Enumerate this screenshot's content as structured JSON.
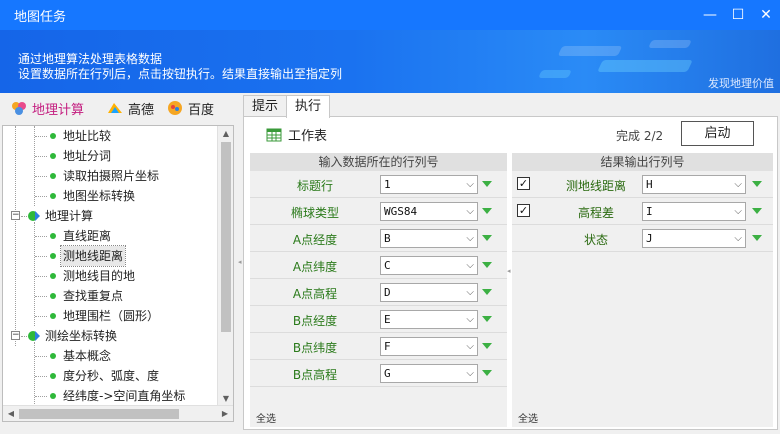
{
  "window": {
    "title": "地图任务",
    "minimize": "—",
    "maximize": "☐",
    "close": "✕"
  },
  "banner": {
    "line1": "通过地理算法处理表格数据",
    "line2": "设置数据所在行列后，点击按钮执行。结果直接输出至指定列",
    "discover": "发现地理价值"
  },
  "left_tabs": [
    {
      "label": "地理计算",
      "icon": "geo-calc-icon"
    },
    {
      "label": "高德",
      "icon": "amap-icon"
    },
    {
      "label": "百度",
      "icon": "baidu-map-icon"
    }
  ],
  "tree": [
    {
      "type": "child",
      "label": "地址比较"
    },
    {
      "type": "child",
      "label": "地址分词"
    },
    {
      "type": "child",
      "label": "读取拍摄照片坐标"
    },
    {
      "type": "child",
      "label": "地图坐标转换"
    },
    {
      "type": "group",
      "label": "地理计算",
      "expander": "−"
    },
    {
      "type": "child",
      "label": "直线距离"
    },
    {
      "type": "child",
      "label": "测地线距离",
      "selected": true
    },
    {
      "type": "child",
      "label": "测地线目的地"
    },
    {
      "type": "child",
      "label": "查找重复点"
    },
    {
      "type": "child",
      "label": "地理围栏（圆形）"
    },
    {
      "type": "group",
      "label": "测绘坐标转换",
      "expander": "−"
    },
    {
      "type": "child",
      "label": "基本概念"
    },
    {
      "type": "child",
      "label": "度分秒、弧度、度"
    },
    {
      "type": "child",
      "label": "经纬度->空间直角坐标"
    }
  ],
  "tabs": [
    {
      "label": "提示",
      "active": false
    },
    {
      "label": "执行",
      "active": true
    }
  ],
  "toolbar": {
    "worksheet_label": "工作表",
    "progress_text": "完成 2/2",
    "start_label": "启动"
  },
  "input_panel": {
    "header": "输入数据所在的行列号",
    "rows": [
      {
        "label": "标题行",
        "value": "1"
      },
      {
        "label": "椭球类型",
        "value": "WGS84"
      },
      {
        "label": "A点经度",
        "value": "B"
      },
      {
        "label": "A点纬度",
        "value": "C"
      },
      {
        "label": "A点高程",
        "value": "D"
      },
      {
        "label": "B点经度",
        "value": "E"
      },
      {
        "label": "B点纬度",
        "value": "F"
      },
      {
        "label": "B点高程",
        "value": "G"
      }
    ],
    "select_all": "全选"
  },
  "output_panel": {
    "header": "结果输出行列号",
    "rows": [
      {
        "label": "测地线距离",
        "value": "H",
        "checked": true,
        "check_glyph": "✓"
      },
      {
        "label": "高程差",
        "value": "I",
        "checked": true,
        "check_glyph": "✓"
      },
      {
        "label": "状态",
        "value": "J",
        "checked": false,
        "check_glyph": ""
      }
    ],
    "select_all": "全选"
  },
  "colors": {
    "titlebar": "#1677ff",
    "accent_green": "#3cb043",
    "label_green": "#2a7a1a",
    "active_tab_magenta": "#c41d7f"
  }
}
